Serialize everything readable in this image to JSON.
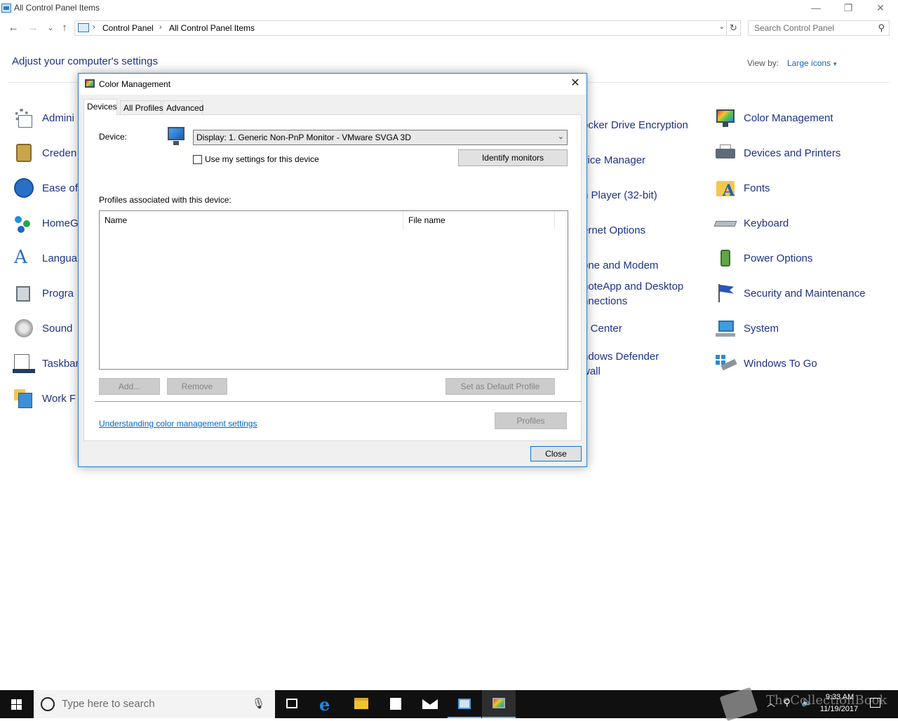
{
  "window": {
    "title": "All Control Panel Items",
    "min_glyph": "—",
    "max_glyph": "❐",
    "close_glyph": "✕"
  },
  "nav": {
    "back_glyph": "←",
    "forward_glyph": "→",
    "recent_glyph": "⌄",
    "up_glyph": "↑"
  },
  "address": {
    "crumbs": [
      "Control Panel",
      "All Control Panel Items"
    ],
    "separator": "›",
    "dropdown_glyph": "⌄",
    "refresh_glyph": "↻"
  },
  "search": {
    "placeholder": "Search Control Panel",
    "icon": "search-icon"
  },
  "page": {
    "heading": "Adjust your computer's settings",
    "view_by_label": "View by:",
    "view_by_value": "Large icons",
    "view_by_caret": "▾"
  },
  "items": {
    "col1": [
      "Admini",
      "Creden",
      "Ease of",
      "HomeG",
      "Langua",
      "Progra",
      "Sound",
      "Taskbar",
      "Work F"
    ],
    "col3": [
      "ocker Drive Encryption",
      "vice Manager",
      "h Player (32-bit)",
      "ernet Options",
      "one and Modem",
      "noteApp and Desktop",
      "nnections",
      "c Center",
      "ndows Defender",
      "wall"
    ],
    "col4": [
      "Color Management",
      "Devices and Printers",
      "Fonts",
      "Keyboard",
      "Power Options",
      "Security and Maintenance",
      "System",
      "Windows To Go"
    ]
  },
  "dialog": {
    "title": "Color Management",
    "close_glyph": "✕",
    "tabs": [
      "Devices",
      "All Profiles",
      "Advanced"
    ],
    "device_label": "Device:",
    "device_value": "Display: 1. Generic Non-PnP Monitor - VMware SVGA 3D",
    "device_chevron": "⌄",
    "use_settings_label": "Use my settings for this device",
    "use_settings_checked": false,
    "identify_button": "Identify monitors",
    "profiles_label": "Profiles associated with this device:",
    "columns": [
      "Name",
      "File name"
    ],
    "add_button": "Add...",
    "remove_button": "Remove",
    "set_default_button": "Set as Default Profile",
    "profiles_button": "Profiles",
    "link": "Understanding color management settings",
    "close_button": "Close"
  },
  "taskbar": {
    "search_placeholder": "Type here to search",
    "mic_glyph": "🎙",
    "tray_up": "︿",
    "tray_net": "⚲",
    "tray_vol": "🔈",
    "time": "9:33 AM",
    "date": "11/19/2017",
    "watermark": "TheCollectionBook"
  }
}
